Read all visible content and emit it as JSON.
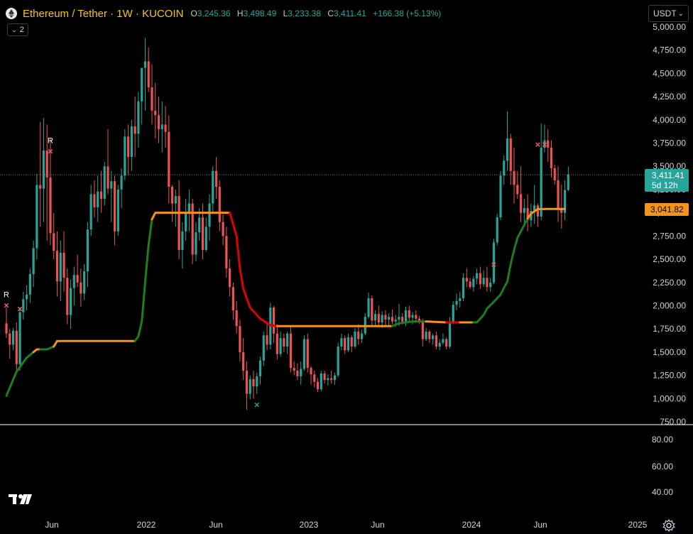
{
  "header": {
    "title": "Ethereum / Tether · 1W · KUCOIN",
    "open_key": "O",
    "open": "3,245.36",
    "high_key": "H",
    "high": "3,498.49",
    "low_key": "L",
    "low": "3,233.38",
    "close_key": "C",
    "close": "3,411.41",
    "change": "+166.38 (+5.13%)",
    "indicators_count": "2"
  },
  "currency_selector": {
    "value": "USDT"
  },
  "price_axis": {
    "ticks": [
      "5,000.00",
      "4,750.00",
      "4,500.00",
      "4,250.00",
      "4,000.00",
      "3,750.00",
      "3,500.00",
      "3,250.00",
      "3,000.00",
      "2,750.00",
      "2,500.00",
      "2,250.00",
      "2,000.00",
      "1,750.00",
      "1,500.00",
      "1,250.00",
      "1,000.00",
      "750.00"
    ],
    "last_price_label": "3,411.41",
    "countdown_label": "5d 12h",
    "supertrend_label": "3,041.82"
  },
  "oscillator_axis": {
    "ticks": [
      "80.00",
      "60.00",
      "40.00"
    ]
  },
  "time_axis": {
    "ticks": [
      "Jun",
      "2022",
      "Jun",
      "2023",
      "Jun",
      "2024",
      "Jun",
      "2025"
    ]
  },
  "markers": {
    "reversal_label": "R",
    "cross_glyph": "×"
  },
  "colors": {
    "up": "#26a69a",
    "down": "#ef5350",
    "trend_green": "#1b7f1b",
    "trend_red": "#e00000",
    "trend_orange": "#f7931a",
    "title": "#f5c518",
    "panel_border": "#ffffff"
  },
  "chart_data": {
    "type": "candlestick",
    "symbol": "Ethereum / Tether",
    "interval": "1W",
    "exchange": "KUCOIN",
    "ylim": [
      750,
      5000
    ],
    "candles": [
      [
        1810,
        1980,
        1650,
        1700
      ],
      [
        1700,
        1750,
        1430,
        1580
      ],
      [
        1580,
        1760,
        1520,
        1730
      ],
      [
        1730,
        1820,
        1290,
        1370
      ],
      [
        1370,
        1980,
        1300,
        1930
      ],
      [
        1930,
        2150,
        1850,
        2070
      ],
      [
        2070,
        2220,
        1950,
        2120
      ],
      [
        2120,
        2400,
        2030,
        2340
      ],
      [
        2340,
        2700,
        2200,
        2620
      ],
      [
        2620,
        3420,
        2500,
        3300
      ],
      [
        3300,
        3980,
        2850,
        3260
      ],
      [
        3260,
        4020,
        2900,
        3670
      ],
      [
        3670,
        3950,
        2700,
        3380
      ],
      [
        3380,
        3800,
        2650,
        2780
      ],
      [
        2780,
        3000,
        2500,
        2590
      ],
      [
        2590,
        2800,
        2100,
        2260
      ],
      [
        2260,
        2700,
        2050,
        2570
      ],
      [
        2570,
        2800,
        2150,
        2300
      ],
      [
        2300,
        2400,
        1800,
        1900
      ],
      [
        1900,
        2280,
        1750,
        2190
      ],
      [
        2190,
        2420,
        2000,
        2330
      ],
      [
        2330,
        2550,
        2200,
        2250
      ],
      [
        2250,
        2400,
        1990,
        2130
      ],
      [
        2130,
        2450,
        2060,
        2370
      ],
      [
        2370,
        2900,
        2200,
        2820
      ],
      [
        2820,
        3300,
        2750,
        3200
      ],
      [
        3200,
        3350,
        2950,
        3060
      ],
      [
        3060,
        3400,
        2900,
        3230
      ],
      [
        3230,
        3450,
        3000,
        3150
      ],
      [
        3150,
        3550,
        3080,
        3500
      ],
      [
        3500,
        3900,
        3200,
        3260
      ],
      [
        3260,
        3450,
        2900,
        3340
      ],
      [
        3340,
        3400,
        2650,
        2800
      ],
      [
        2800,
        3300,
        2750,
        3250
      ],
      [
        3250,
        3480,
        3050,
        3400
      ],
      [
        3400,
        3900,
        3350,
        3820
      ],
      [
        3820,
        3950,
        3400,
        3600
      ],
      [
        3600,
        4000,
        3450,
        3930
      ],
      [
        3930,
        4250,
        3600,
        3850
      ],
      [
        3850,
        4300,
        3700,
        4200
      ],
      [
        4200,
        4500,
        3950,
        4560
      ],
      [
        4560,
        4880,
        4100,
        4630
      ],
      [
        4630,
        4780,
        4300,
        4350
      ],
      [
        4350,
        4600,
        3950,
        4100
      ],
      [
        4100,
        4400,
        3800,
        4050
      ],
      [
        4050,
        4250,
        3750,
        3900
      ],
      [
        3900,
        4200,
        3650,
        3950
      ],
      [
        3950,
        4150,
        3700,
        3870
      ],
      [
        3870,
        4050,
        3100,
        3280
      ],
      [
        3280,
        3300,
        2900,
        3100
      ],
      [
        3100,
        3250,
        2850,
        3180
      ],
      [
        3180,
        3350,
        2500,
        2600
      ],
      [
        2600,
        2900,
        2400,
        2800
      ],
      [
        2800,
        3150,
        2700,
        3000
      ],
      [
        3000,
        3250,
        2800,
        3100
      ],
      [
        3100,
        3150,
        2450,
        2550
      ],
      [
        2550,
        2900,
        2480,
        2790
      ],
      [
        2790,
        3050,
        2700,
        2950
      ],
      [
        2950,
        3100,
        2500,
        2600
      ],
      [
        2600,
        2950,
        2580,
        2850
      ],
      [
        2850,
        3200,
        2700,
        3100
      ],
      [
        3100,
        3500,
        3000,
        3450
      ],
      [
        3450,
        3600,
        3150,
        3280
      ],
      [
        3280,
        3350,
        2800,
        2900
      ],
      [
        2900,
        2980,
        2650,
        2750
      ],
      [
        2750,
        2850,
        2300,
        2400
      ],
      [
        2400,
        2500,
        2100,
        2200
      ],
      [
        2200,
        2250,
        1850,
        1950
      ],
      [
        1950,
        2050,
        1700,
        1780
      ],
      [
        1780,
        1850,
        1400,
        1500
      ],
      [
        1500,
        1650,
        1200,
        1300
      ],
      [
        1300,
        1400,
        880,
        1050
      ],
      [
        1050,
        1250,
        990,
        1210
      ],
      [
        1210,
        1300,
        1000,
        1130
      ],
      [
        1130,
        1280,
        1050,
        1240
      ],
      [
        1240,
        1450,
        1150,
        1410
      ],
      [
        1410,
        1720,
        1350,
        1680
      ],
      [
        1680,
        1800,
        1520,
        1580
      ],
      [
        1580,
        2030,
        1530,
        1980
      ],
      [
        1980,
        2000,
        1600,
        1700
      ],
      [
        1700,
        1800,
        1420,
        1480
      ],
      [
        1480,
        1720,
        1450,
        1650
      ],
      [
        1650,
        1700,
        1500,
        1560
      ],
      [
        1560,
        1720,
        1480,
        1700
      ],
      [
        1700,
        1790,
        1280,
        1330
      ],
      [
        1330,
        1400,
        1250,
        1300
      ],
      [
        1300,
        1380,
        1200,
        1240
      ],
      [
        1240,
        1400,
        1150,
        1320
      ],
      [
        1320,
        1680,
        1300,
        1640
      ],
      [
        1640,
        1700,
        1280,
        1330
      ],
      [
        1330,
        1350,
        1150,
        1260
      ],
      [
        1260,
        1300,
        1120,
        1180
      ],
      [
        1180,
        1220,
        1070,
        1100
      ],
      [
        1100,
        1300,
        1080,
        1270
      ],
      [
        1270,
        1300,
        1160,
        1200
      ],
      [
        1200,
        1260,
        1140,
        1220
      ],
      [
        1220,
        1300,
        1160,
        1200
      ],
      [
        1200,
        1280,
        1150,
        1250
      ],
      [
        1250,
        1600,
        1230,
        1560
      ],
      [
        1560,
        1700,
        1520,
        1650
      ],
      [
        1650,
        1680,
        1480,
        1520
      ],
      [
        1520,
        1700,
        1500,
        1660
      ],
      [
        1660,
        1680,
        1500,
        1560
      ],
      [
        1560,
        1760,
        1540,
        1720
      ],
      [
        1720,
        1800,
        1580,
        1640
      ],
      [
        1640,
        1740,
        1600,
        1700
      ],
      [
        1700,
        1920,
        1680,
        1880
      ],
      [
        1880,
        2140,
        1860,
        2080
      ],
      [
        2080,
        2110,
        1780,
        1840
      ],
      [
        1840,
        1950,
        1780,
        1910
      ],
      [
        1910,
        2000,
        1780,
        1820
      ],
      [
        1820,
        1940,
        1760,
        1900
      ],
      [
        1900,
        1950,
        1790,
        1850
      ],
      [
        1850,
        1920,
        1780,
        1880
      ],
      [
        1880,
        1960,
        1800,
        1830
      ],
      [
        1830,
        1900,
        1770,
        1850
      ],
      [
        1850,
        2020,
        1780,
        1880
      ],
      [
        1880,
        1920,
        1800,
        1830
      ],
      [
        1830,
        1990,
        1780,
        1950
      ],
      [
        1950,
        2000,
        1820,
        1870
      ],
      [
        1870,
        1930,
        1800,
        1900
      ],
      [
        1900,
        1950,
        1830,
        1860
      ],
      [
        1860,
        1890,
        1800,
        1830
      ],
      [
        1830,
        1860,
        1560,
        1640
      ],
      [
        1640,
        1760,
        1620,
        1720
      ],
      [
        1720,
        1740,
        1600,
        1640
      ],
      [
        1640,
        1700,
        1580,
        1680
      ],
      [
        1680,
        1720,
        1530,
        1560
      ],
      [
        1560,
        1640,
        1520,
        1600
      ],
      [
        1600,
        1700,
        1580,
        1640
      ],
      [
        1640,
        1660,
        1530,
        1560
      ],
      [
        1560,
        1880,
        1540,
        1820
      ],
      [
        1820,
        2050,
        1800,
        2010
      ],
      [
        2010,
        2130,
        1950,
        2050
      ],
      [
        2050,
        2150,
        1980,
        2080
      ],
      [
        2080,
        2350,
        2050,
        2300
      ],
      [
        2300,
        2400,
        2200,
        2260
      ],
      [
        2260,
        2300,
        2180,
        2200
      ],
      [
        2200,
        2320,
        2150,
        2290
      ],
      [
        2290,
        2400,
        2230,
        2350
      ],
      [
        2350,
        2420,
        2180,
        2230
      ],
      [
        2230,
        2380,
        2200,
        2300
      ],
      [
        2300,
        2420,
        2150,
        2200
      ],
      [
        2200,
        2300,
        2150,
        2250
      ],
      [
        2250,
        2720,
        2230,
        2680
      ],
      [
        2680,
        2990,
        2650,
        2950
      ],
      [
        2950,
        3450,
        2920,
        3400
      ],
      [
        3400,
        3620,
        3300,
        3560
      ],
      [
        3560,
        4090,
        3450,
        3800
      ],
      [
        3800,
        3850,
        3300,
        3450
      ],
      [
        3450,
        3700,
        3100,
        3300
      ],
      [
        3300,
        3450,
        3150,
        3200
      ],
      [
        3200,
        3500,
        2900,
        3000
      ],
      [
        3000,
        3150,
        2850,
        3050
      ],
      [
        3050,
        3200,
        2800,
        2920
      ],
      [
        2920,
        3100,
        2850,
        3020
      ],
      [
        3020,
        3300,
        2880,
        3080
      ],
      [
        3080,
        3100,
        2850,
        2960
      ],
      [
        2960,
        3960,
        2920,
        3700
      ],
      [
        3700,
        3950,
        3650,
        3780
      ],
      [
        3780,
        3900,
        3550,
        3700
      ],
      [
        3700,
        3780,
        3380,
        3480
      ],
      [
        3480,
        3520,
        3300,
        3350
      ],
      [
        3350,
        3500,
        2900,
        3050
      ],
      [
        3050,
        3300,
        2830,
        3000
      ],
      [
        3000,
        3350,
        2920,
        3245.36
      ],
      [
        3245.36,
        3498.49,
        3233.38,
        3411.41
      ]
    ],
    "trend_line": [
      [
        0,
        1030
      ],
      [
        3,
        1290
      ],
      [
        6,
        1440
      ],
      [
        8,
        1500
      ],
      [
        9,
        1530
      ],
      [
        12,
        1530
      ],
      [
        14,
        1560
      ],
      [
        15,
        1620
      ],
      [
        38,
        1620
      ],
      [
        39,
        1670
      ],
      [
        40,
        1830
      ],
      [
        41,
        2250
      ],
      [
        42,
        2650
      ],
      [
        43,
        2930
      ],
      [
        44,
        3000
      ],
      [
        66,
        3000
      ],
      [
        68,
        2750
      ],
      [
        69,
        2400
      ],
      [
        70,
        2180
      ],
      [
        72,
        1980
      ],
      [
        75,
        1860
      ],
      [
        78,
        1790
      ],
      [
        80,
        1780
      ],
      [
        114,
        1780
      ],
      [
        116,
        1810
      ],
      [
        120,
        1830
      ],
      [
        124,
        1830
      ],
      [
        130,
        1820
      ],
      [
        139,
        1820
      ],
      [
        141,
        1900
      ],
      [
        142,
        1970
      ],
      [
        144,
        2040
      ],
      [
        145,
        2080
      ],
      [
        146,
        2120
      ],
      [
        148,
        2260
      ],
      [
        149,
        2450
      ],
      [
        150,
        2600
      ],
      [
        151,
        2730
      ],
      [
        153,
        2870
      ],
      [
        154,
        2940
      ],
      [
        155,
        2990
      ],
      [
        157,
        3040
      ],
      [
        165,
        3041.82
      ]
    ],
    "trend_segments": [
      {
        "from": 0,
        "to": 8,
        "color": "green"
      },
      {
        "from": 8,
        "to": 10,
        "color": "orange"
      },
      {
        "from": 10,
        "to": 14,
        "color": "green"
      },
      {
        "from": 14,
        "to": 38,
        "color": "orange"
      },
      {
        "from": 38,
        "to": 43,
        "color": "green"
      },
      {
        "from": 43,
        "to": 66,
        "color": "orange"
      },
      {
        "from": 66,
        "to": 80,
        "color": "red"
      },
      {
        "from": 80,
        "to": 114,
        "color": "orange"
      },
      {
        "from": 114,
        "to": 124,
        "color": "green"
      },
      {
        "from": 124,
        "to": 130,
        "color": "orange"
      },
      {
        "from": 130,
        "to": 134,
        "color": "red"
      },
      {
        "from": 134,
        "to": 138,
        "color": "orange"
      },
      {
        "from": 138,
        "to": 154,
        "color": "green"
      },
      {
        "from": 154,
        "to": 165,
        "color": "orange"
      }
    ],
    "signals": [
      {
        "i": 0,
        "price": 2000,
        "type": "R",
        "color": "red"
      },
      {
        "i": 4,
        "price": 1960,
        "type": "x",
        "color": "red"
      },
      {
        "i": 13,
        "price": 3660,
        "type": "R",
        "color": "red"
      },
      {
        "i": 74,
        "price": 930,
        "type": "x",
        "color": "green"
      },
      {
        "i": 144,
        "price": 2440,
        "type": "x",
        "color": "red"
      },
      {
        "i": 157,
        "price": 3730,
        "type": "x",
        "color": "red"
      },
      {
        "i": 159,
        "price": 3730,
        "type": "x",
        "color": "red"
      }
    ]
  }
}
